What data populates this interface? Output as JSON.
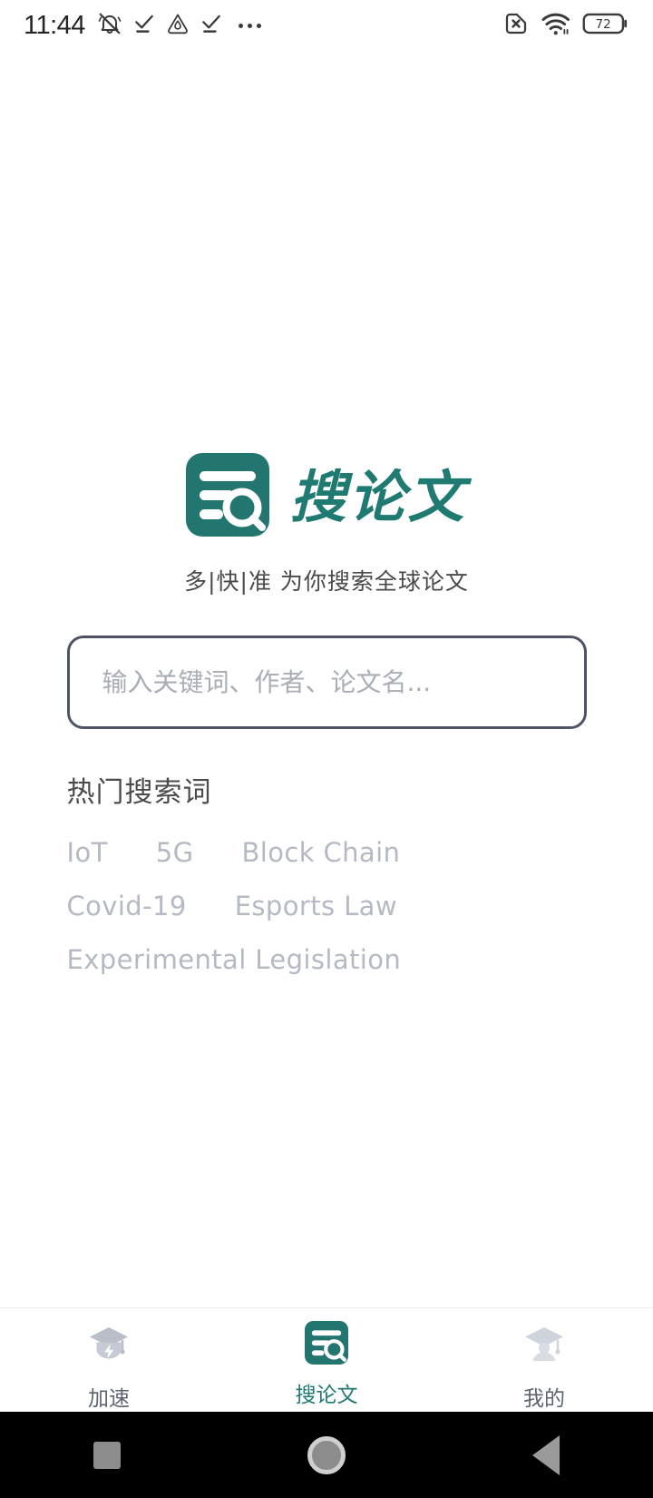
{
  "status_bar": {
    "time": "11:44",
    "left_icons": [
      "bell-muted-icon",
      "check-underline-icon",
      "water-drop-icon",
      "check-underline-icon",
      "overflow-dots-icon"
    ],
    "right_icons": [
      "no-sim-icon",
      "wifi-icon",
      "battery-icon"
    ],
    "battery_level": "72"
  },
  "brand": {
    "name": "搜论文",
    "logo_icon": "document-search-logo-icon",
    "tagline": "多|快|准 为你搜索全球论文",
    "accent_color": "#1f7a72"
  },
  "search": {
    "value": "",
    "placeholder": "输入关键词、作者、论文名...",
    "border_color": "#4d5565"
  },
  "hot_search": {
    "title": "热门搜索词",
    "tags": [
      "IoT",
      "5G",
      "Block Chain",
      "Covid-19",
      "Esports Law",
      "Experimental Legislation"
    ],
    "tag_color": "#b4b9c4"
  },
  "tabbar": {
    "active_index": 1,
    "items": [
      {
        "label": "加速",
        "icon": "graduation-cap-bolt-icon"
      },
      {
        "label": "搜论文",
        "icon": "document-search-icon"
      },
      {
        "label": "我的",
        "icon": "graduation-cap-user-icon"
      }
    ]
  },
  "nav_bar": {
    "items": [
      "recents-square-icon",
      "home-circle-icon",
      "back-triangle-icon"
    ]
  }
}
